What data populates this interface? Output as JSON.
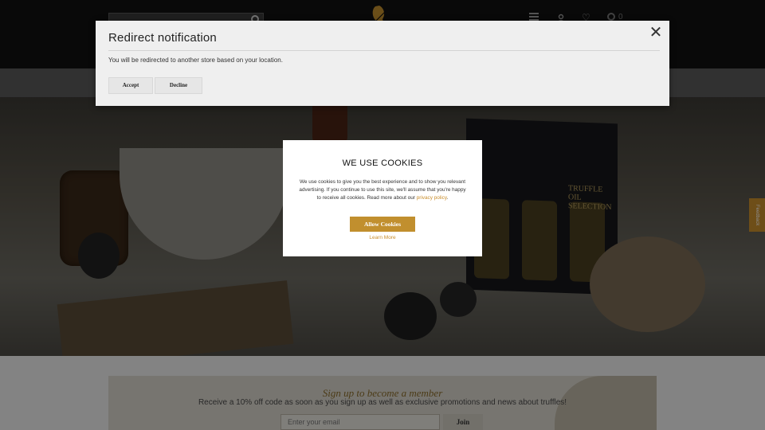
{
  "header": {
    "search_placeholder": "",
    "cart_text": "0"
  },
  "hero": {
    "box_text": "TRUFFLE OIL SELECTION"
  },
  "feedback": {
    "label": "Feedback"
  },
  "signup": {
    "title": "Sign up to become a member",
    "subtitle": "Receive a 10% off code as soon as you sign up as well as exclusive promotions and news about truffles!",
    "email_placeholder": "Enter your email",
    "join_label": "Join"
  },
  "redirect": {
    "title": "Redirect notification",
    "message": "You will be redirected to another store based on your location.",
    "accept_label": "Accept",
    "decline_label": "Decline",
    "close_glyph": "✕"
  },
  "cookie": {
    "title": "WE USE COOKIES",
    "text": "We use cookies to give you the best experience and to show you relevant advertising. If you continue to use this site, we'll assume that you're happy to receive all cookies. Read more about our",
    "privacy_link": "privacy policy",
    "allow_label": "Allow Cookies",
    "learn_more_label": "Learn More"
  },
  "colors": {
    "accent": "#c18f2e",
    "header_bg": "#111111"
  }
}
